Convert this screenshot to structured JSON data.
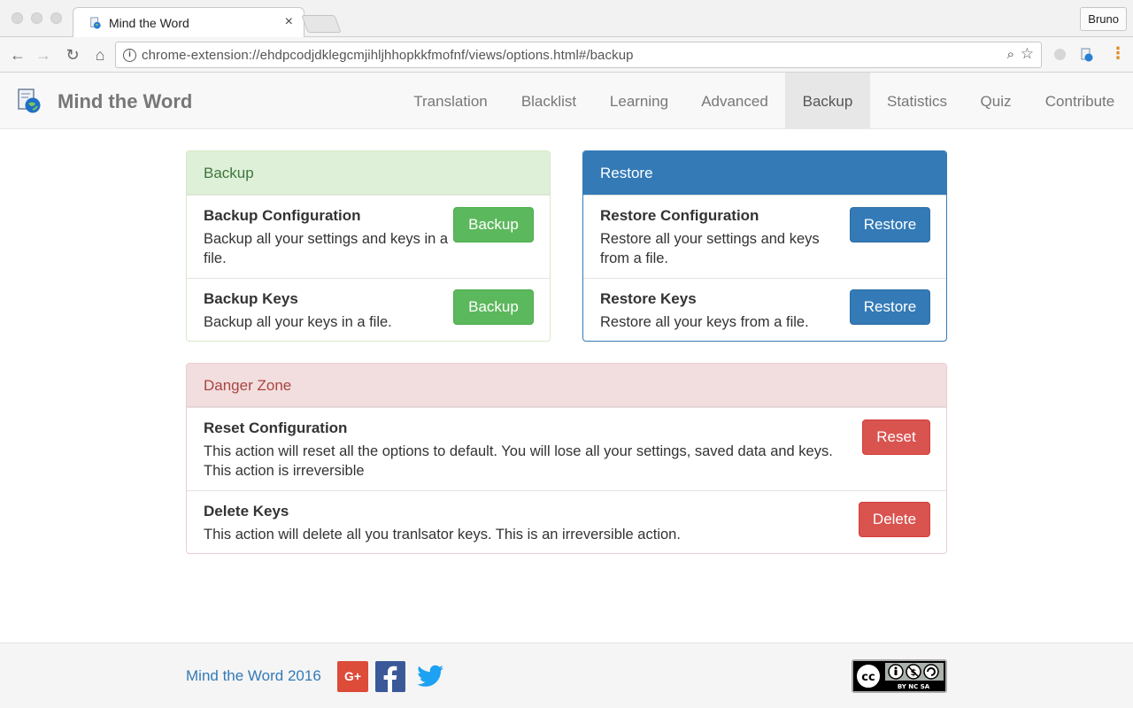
{
  "browser": {
    "tab_title": "Mind the Word",
    "url": "chrome-extension://ehdpcodjdklegcmjihljhhopkkfmofnf/views/options.html#/backup",
    "profile_name": "Bruno",
    "close_glyph": "×"
  },
  "navbar": {
    "brand": "Mind the Word",
    "items": [
      {
        "label": "Translation",
        "active": false
      },
      {
        "label": "Blacklist",
        "active": false
      },
      {
        "label": "Learning",
        "active": false
      },
      {
        "label": "Advanced",
        "active": false
      },
      {
        "label": "Backup",
        "active": true
      },
      {
        "label": "Statistics",
        "active": false
      },
      {
        "label": "Quiz",
        "active": false
      },
      {
        "label": "Contribute",
        "active": false
      }
    ]
  },
  "backup_panel": {
    "heading": "Backup",
    "rows": [
      {
        "title": "Backup Configuration",
        "text": "Backup all your settings and keys in a file.",
        "button": "Backup"
      },
      {
        "title": "Backup Keys",
        "text": "Backup all your keys in a file.",
        "button": "Backup"
      }
    ]
  },
  "restore_panel": {
    "heading": "Restore",
    "rows": [
      {
        "title": "Restore Configuration",
        "text": "Restore all your settings and keys from a file.",
        "button": "Restore"
      },
      {
        "title": "Restore Keys",
        "text": "Restore all your keys from a file.",
        "button": "Restore"
      }
    ]
  },
  "danger_panel": {
    "heading": "Danger Zone",
    "rows": [
      {
        "title": "Reset Configuration",
        "text": "This action will reset all the options to default. You will lose all your settings, saved data and keys. This action is irreversible",
        "button": "Reset"
      },
      {
        "title": "Delete Keys",
        "text": "This action will delete all you tranlsator keys. This is an irreversible action.",
        "button": "Delete"
      }
    ]
  },
  "footer": {
    "link_text": "Mind the Word 2016",
    "gplus_label": "G+",
    "license_text": "BY NC SA"
  },
  "colors": {
    "success": "#5cb85c",
    "primary": "#337ab7",
    "danger": "#d9534f"
  }
}
